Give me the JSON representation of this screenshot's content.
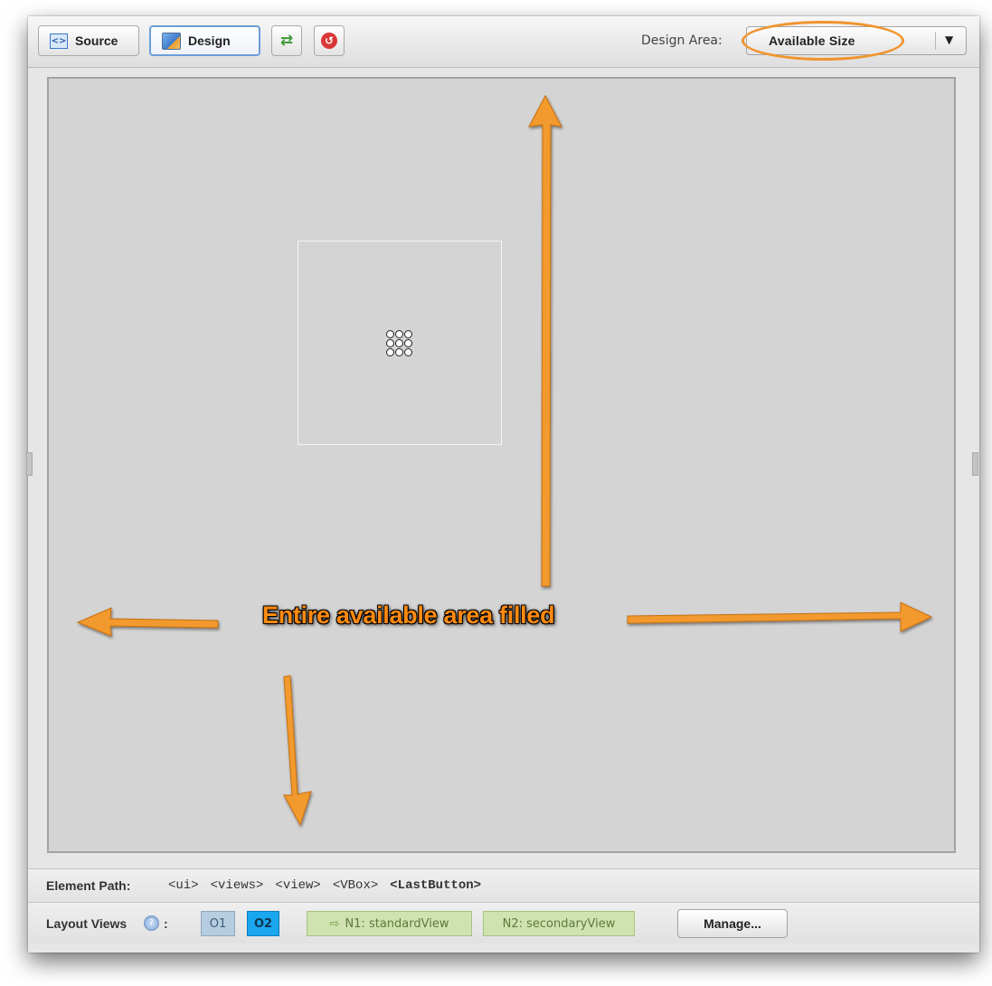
{
  "toolbar": {
    "source_label": "Source",
    "design_label": "Design",
    "design_area_label": "Design Area:",
    "design_area_value": "Available Size"
  },
  "annotation": {
    "text": "Entire available area filled"
  },
  "element_path": {
    "label": "Element Path:",
    "crumbs": [
      "<ui>",
      "<views>",
      "<view>",
      "<VBox>",
      "<LastButton>"
    ]
  },
  "layout_views": {
    "label": "Layout Views",
    "colon": ":",
    "help_icon": "?",
    "chips": [
      "O1",
      "O2",
      "N1: standardView",
      "N2: secondaryView"
    ],
    "manage_label": "Manage..."
  },
  "colors": {
    "annotation_orange": "#ff8a10",
    "arrow_orange": "#f29a2e",
    "selected_chip": "#1aa7ef",
    "new_view_chip": "#cfe2b0"
  },
  "icons": [
    "source-icon",
    "design-icon",
    "refresh-icon",
    "stop-icon",
    "dropdown-arrow-icon",
    "help-icon",
    "arrow-right-icon"
  ]
}
